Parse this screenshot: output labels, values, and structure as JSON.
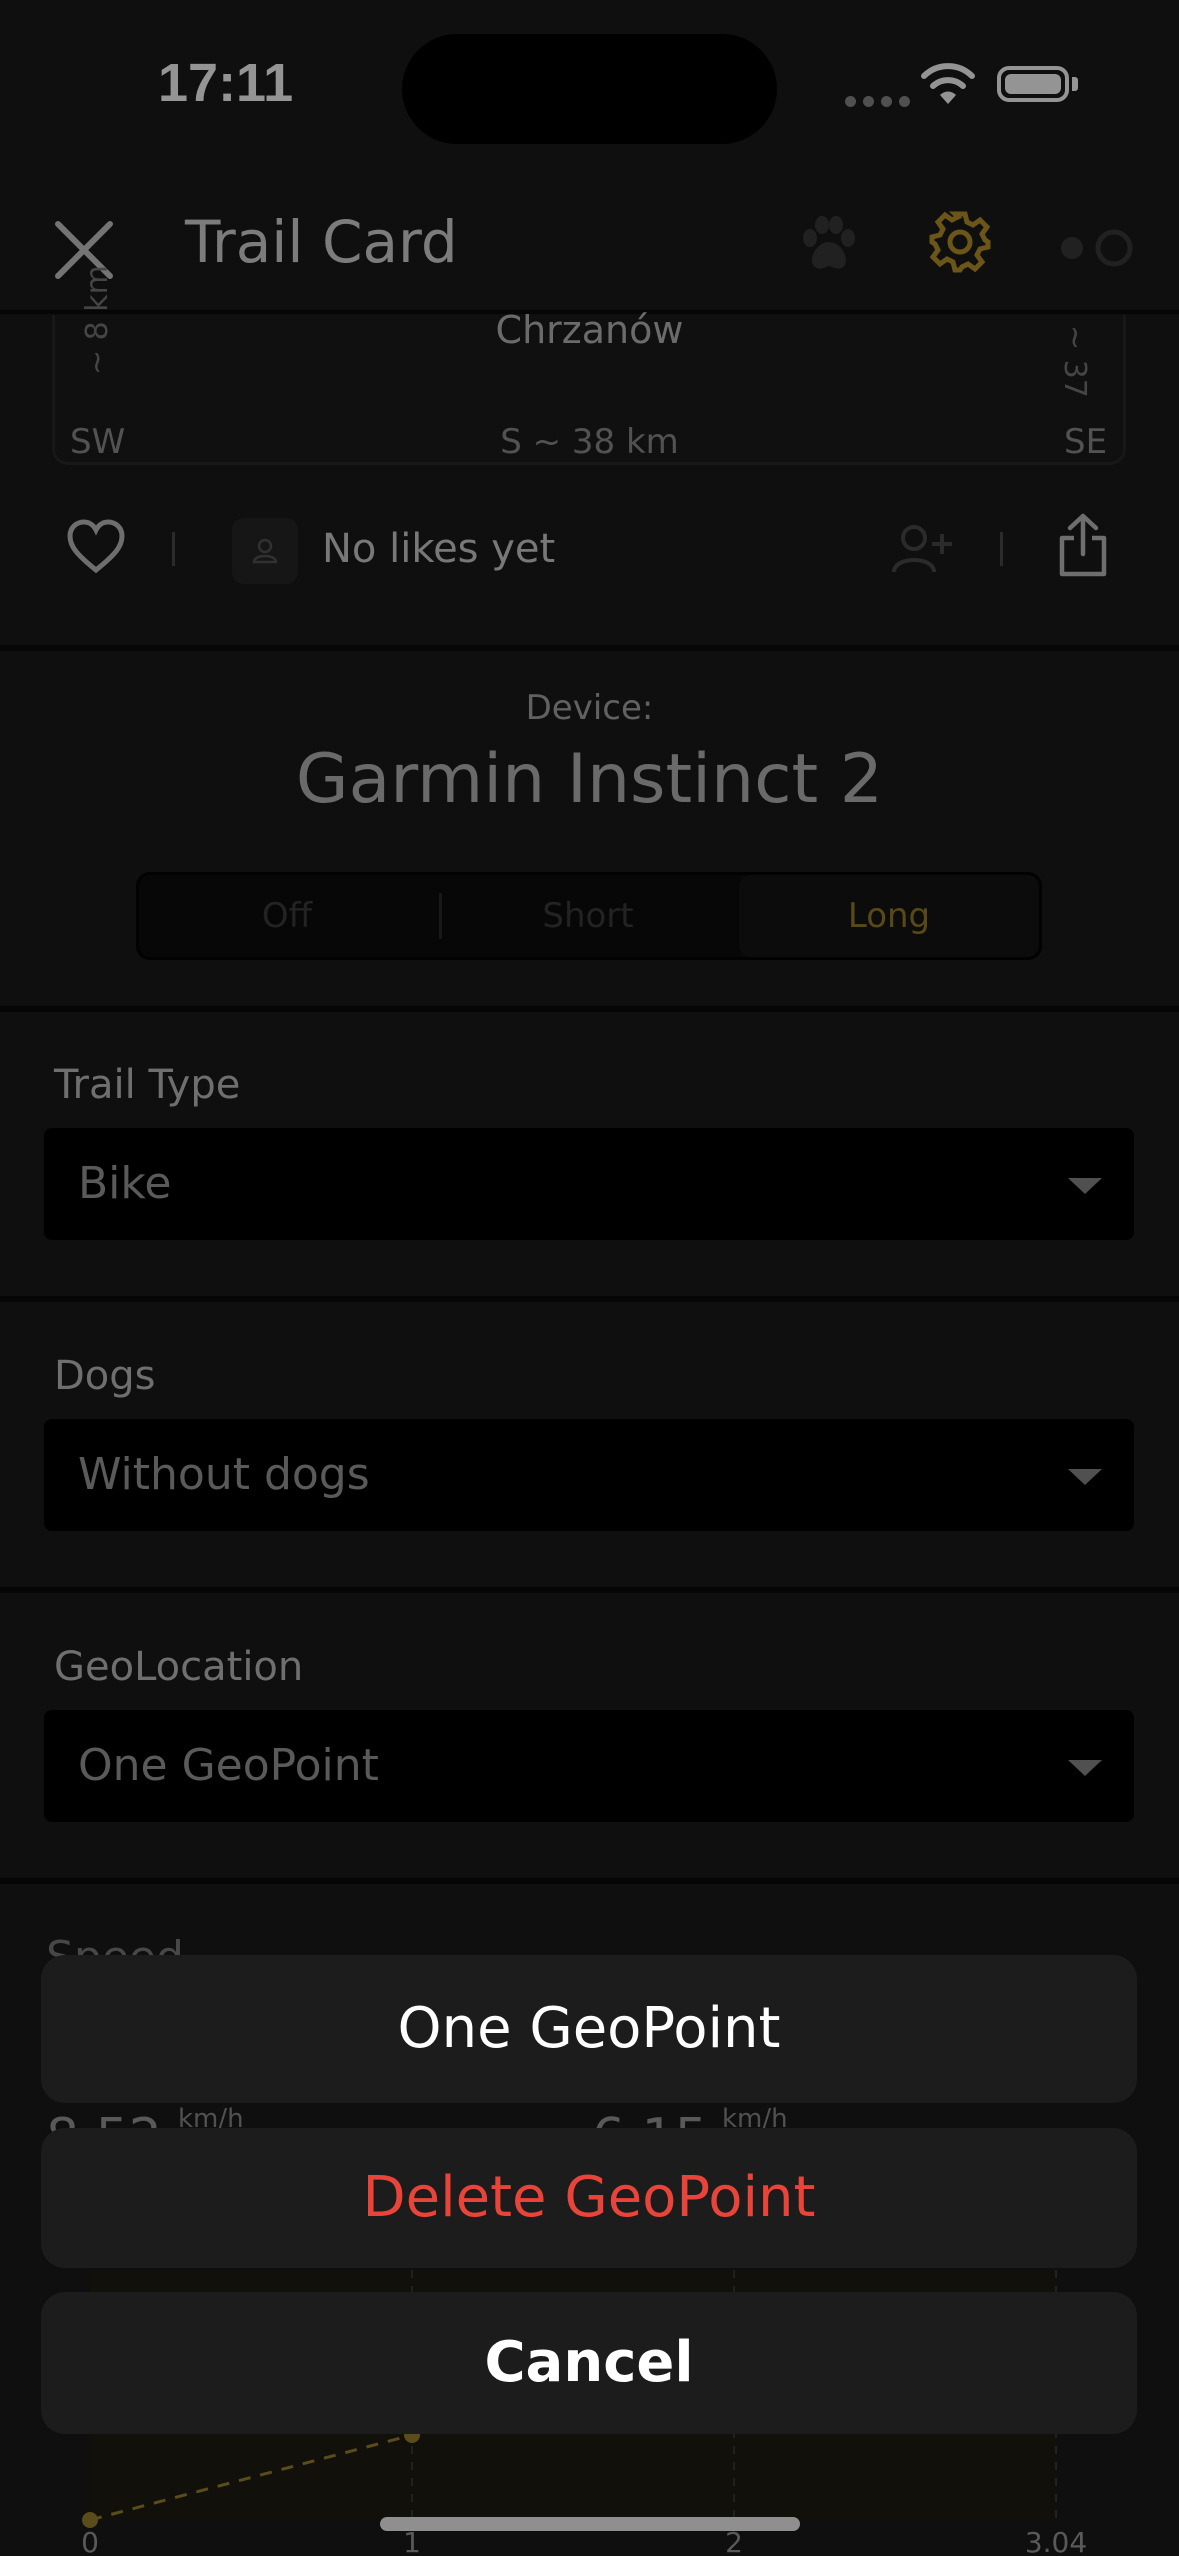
{
  "status_bar": {
    "time": "17:11"
  },
  "header": {
    "title": "Trail Card"
  },
  "compass": {
    "center_label": "Chrzanów",
    "left_label": "SW",
    "right_label": "SE",
    "bottom_label": "S ~ 38 km",
    "west_distance": "~ 8 km",
    "east_distance": "~ 37"
  },
  "likes": {
    "text": "No likes yet"
  },
  "device": {
    "label": "Device:",
    "name": "Garmin Instinct 2",
    "options": [
      "Off",
      "Short",
      "Long"
    ],
    "selected": "Long"
  },
  "sections": [
    {
      "label": "Trail Type",
      "value": "Bike"
    },
    {
      "label": "Dogs",
      "value": "Without dogs"
    },
    {
      "label": "GeoLocation",
      "value": "One GeoPoint"
    }
  ],
  "speed": {
    "label": "Speed",
    "unit_1": "km/h",
    "unit_2": "km/h",
    "value_1": "8.52",
    "value_2": "6.15"
  },
  "chart_axis": [
    "0",
    "1",
    "2",
    "3.04"
  ],
  "action_sheet": {
    "option": "One GeoPoint",
    "destructive": "Delete GeoPoint",
    "cancel": "Cancel"
  },
  "colors": {
    "accent": "#b8952a",
    "destructive": "#e8443a",
    "background": "#1a1a1a"
  }
}
